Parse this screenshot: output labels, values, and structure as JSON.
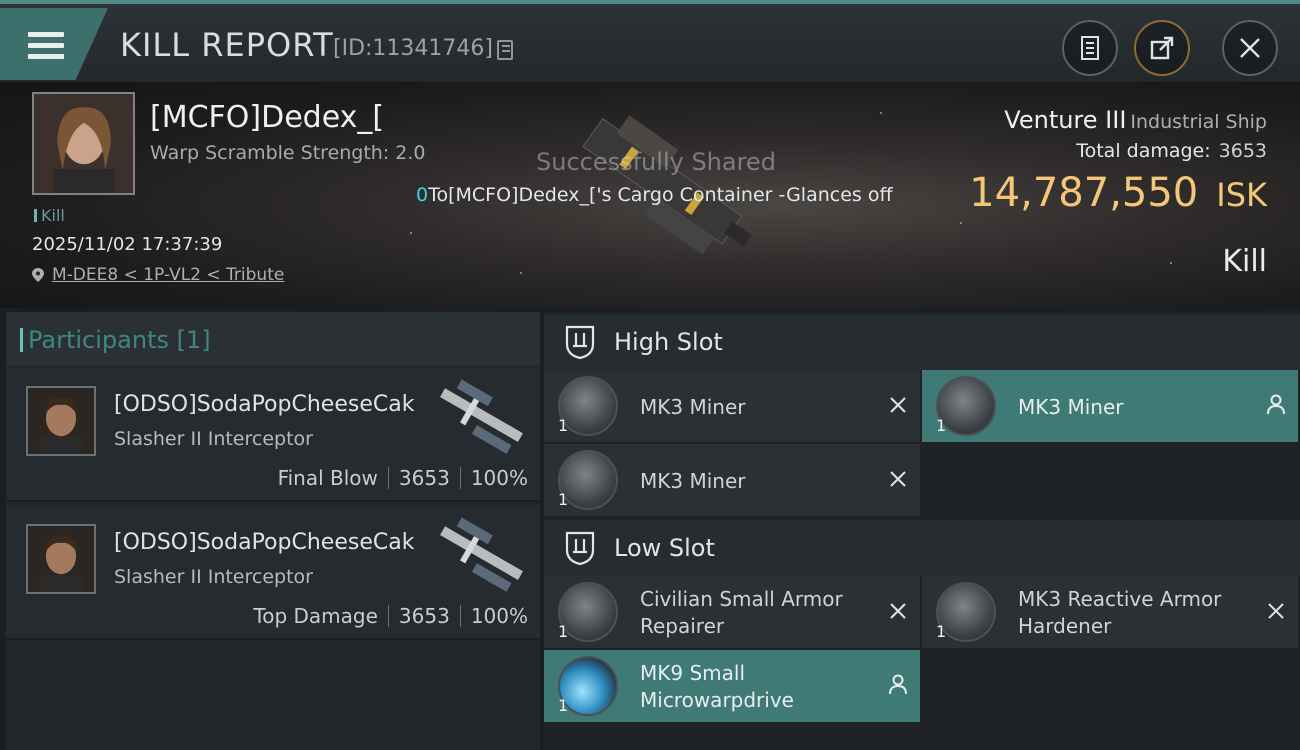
{
  "header": {
    "title": "KILL REPORT",
    "report_id": "[ID:11341746]"
  },
  "victim": {
    "name": "[MCFO]Dedex_[",
    "warp_scramble": "Warp Scramble Strength: 2.0",
    "tag": "Kill",
    "datetime": "2025/11/02 17:37:39",
    "location": "M-DEE8 < 1P-VL2 < Tribute",
    "ship_name": "Venture III",
    "ship_class": "Industrial Ship",
    "total_damage_label": "Total damage:",
    "total_damage": "3653",
    "isk_value": "14,787,550",
    "isk_unit": "ISK",
    "result": "Kill"
  },
  "notice": {
    "shared": "Successfully Shared",
    "combat_prefix": "0",
    "combat_text": "To[MCFO]Dedex_['s Cargo Container -Glances off"
  },
  "participants": {
    "label": "Participants",
    "count": "[1]",
    "rows": [
      {
        "name": "[ODSO]SodaPopCheeseCak",
        "ship": "Slasher II Interceptor",
        "role": "Final Blow",
        "damage": "3653",
        "percent": "100%"
      },
      {
        "name": "[ODSO]SodaPopCheeseCak",
        "ship": "Slasher II Interceptor",
        "role": "Top Damage",
        "damage": "3653",
        "percent": "100%"
      }
    ]
  },
  "slots": {
    "high": {
      "label": "High Slot",
      "modules": [
        {
          "name": "MK3 Miner",
          "qty": "1",
          "state": "destroyed"
        },
        {
          "name": "MK3 Miner",
          "qty": "1",
          "state": "dropped"
        },
        {
          "name": "MK3 Miner",
          "qty": "1",
          "state": "destroyed"
        }
      ]
    },
    "low": {
      "label": "Low Slot",
      "modules": [
        {
          "name": "Civilian Small Armor Repairer",
          "qty": "1",
          "state": "destroyed"
        },
        {
          "name": "MK3 Reactive Armor Hardener",
          "qty": "1",
          "state": "destroyed"
        },
        {
          "name": "MK9 Small Microwarpdrive",
          "qty": "1",
          "state": "dropped"
        }
      ]
    }
  },
  "colors": {
    "accent": "#3f7a76",
    "isk": "#f4c778",
    "combat_highlight": "#3fd2e6"
  },
  "icons": [
    "menu-icon",
    "copy-icon",
    "notepad-icon",
    "share-icon",
    "close-icon",
    "location-pin-icon",
    "slot-icon",
    "destroyed-x-icon",
    "person-icon"
  ]
}
